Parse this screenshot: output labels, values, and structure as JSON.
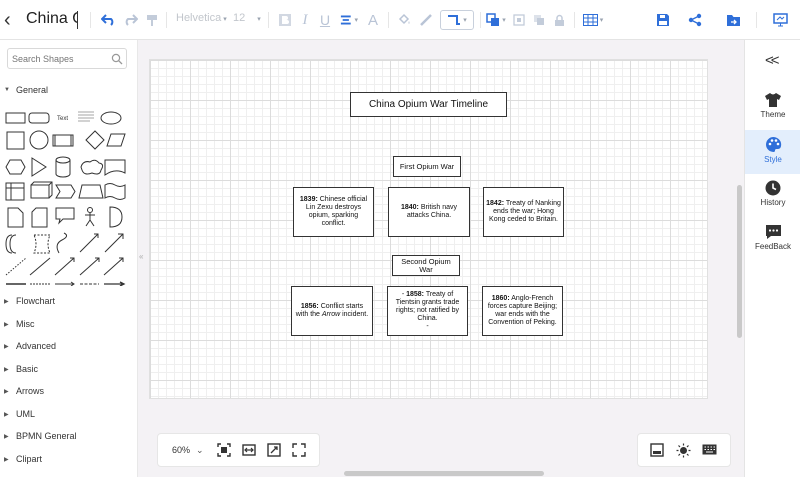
{
  "document": {
    "title": "China O"
  },
  "toolbar": {
    "font_family": "Helvetica",
    "font_size": "12",
    "accent_color": "#2f6fd9"
  },
  "left_panel": {
    "search_placeholder": "Search Shapes",
    "general_label": "General",
    "text_shape_label": "Text",
    "categories": [
      "Flowchart",
      "Misc",
      "Advanced",
      "Basic",
      "Arrows",
      "UML",
      "BPMN General",
      "Clipart"
    ]
  },
  "diagram": {
    "title": "China Opium War Timeline",
    "first_war": {
      "heading": "First Opium War",
      "events": [
        {
          "year": "1839:",
          "text": " Chinese official Lin Zexu destroys opium, sparking conflict."
        },
        {
          "year": "1840:",
          "text": " British navy attacks China."
        },
        {
          "year": "1842:",
          "text": " Treaty of Nanking ends the war; Hong Kong ceded to Britain."
        }
      ]
    },
    "second_war": {
      "heading": "Second Opium War",
      "events": [
        {
          "year": "1856:",
          "text_before": " Conflict starts with the ",
          "italic": "Arrow",
          "text_after": " incident."
        },
        {
          "prefix": "- ",
          "year": "1858:",
          "text": " Treaty of Tientsin grants trade rights; not ratified by China.",
          "suffix": "-"
        },
        {
          "year": "1860:",
          "text": " Anglo-French forces capture Beijing; war ends with the Convention of Peking."
        }
      ]
    }
  },
  "zoom": {
    "value": "60%"
  },
  "right_panel": {
    "tabs": [
      {
        "label": "Theme",
        "icon": "shirt-icon"
      },
      {
        "label": "Style",
        "icon": "palette-icon"
      },
      {
        "label": "History",
        "icon": "clock-icon"
      },
      {
        "label": "FeedBack",
        "icon": "message-icon"
      }
    ]
  }
}
